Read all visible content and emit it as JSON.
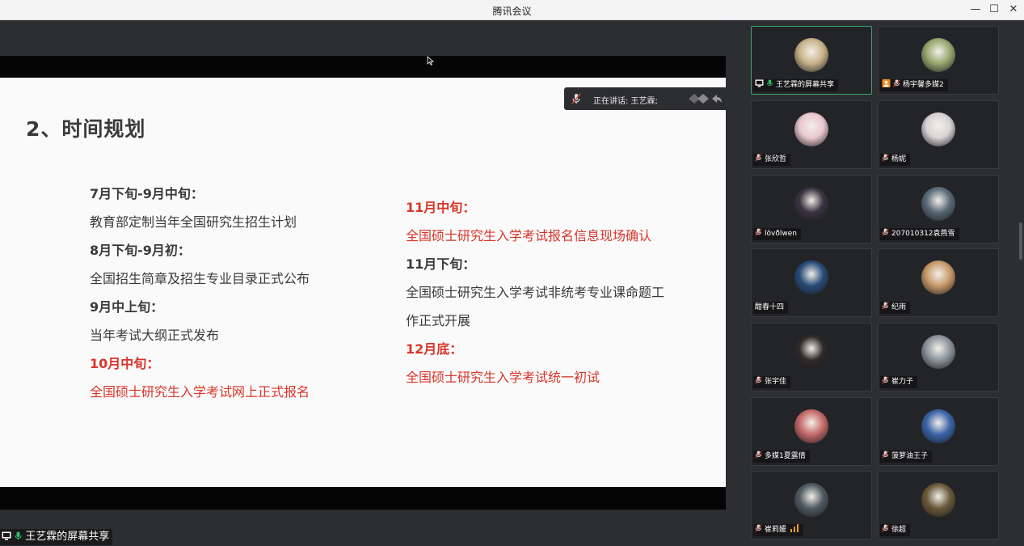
{
  "window": {
    "title": "腾讯会议",
    "minimize": "—",
    "maximize": "☐",
    "close": "✕"
  },
  "slide": {
    "title": "2、时间规划",
    "left_column": [
      {
        "text": "7月下旬-9月中旬：",
        "style": "h"
      },
      {
        "text": "教育部定制当年全国研究生招生计划",
        "style": "t"
      },
      {
        "text": "8月下旬-9月初：",
        "style": "h"
      },
      {
        "text": "全国招生简章及招生专业目录正式公布",
        "style": "t"
      },
      {
        "text": "9月中上旬：",
        "style": "h"
      },
      {
        "text": "当年考试大纲正式发布",
        "style": "t"
      },
      {
        "text": "10月中旬：",
        "style": "hr"
      },
      {
        "text": "全国硕士研究生入学考试网上正式报名",
        "style": "tr"
      }
    ],
    "right_column": [
      {
        "text": "11月中旬：",
        "style": "hr"
      },
      {
        "text": "全国硕士研究生入学考试报名信息现场确认",
        "style": "tr"
      },
      {
        "text": "11月下旬：",
        "style": "h"
      },
      {
        "text": "全国硕士研究生入学考试非统考专业课命题工",
        "style": "t"
      },
      {
        "text": "作正式开展",
        "style": "t"
      },
      {
        "text": "12月底：",
        "style": "hr"
      },
      {
        "text": "全国硕士研究生入学考试统一初试",
        "style": "tr"
      }
    ]
  },
  "speaking": {
    "label": "正在讲话: 王艺霖;"
  },
  "outline_icon": "list-icon",
  "share_label": "王艺霖的屏幕共享",
  "participants": [
    {
      "name": "王艺霖的屏幕共享",
      "badge": "screen-share",
      "active": true,
      "avatar": "#c9b48a"
    },
    {
      "name": "杨宇馨多媒2",
      "badge": "orange-user",
      "active": false,
      "avatar": "#9aa870"
    },
    {
      "name": "张欣哲",
      "badge": "mic-muted",
      "active": false,
      "avatar": "#e9c7cf"
    },
    {
      "name": "杨妮",
      "badge": "mic-muted",
      "active": false,
      "avatar": "#d8d4d6"
    },
    {
      "name": "lövðlwen",
      "badge": "mic-muted",
      "active": false,
      "avatar": "#3a3340"
    },
    {
      "name": "207010312袁燕雪",
      "badge": "mic-muted",
      "active": false,
      "avatar": "#5a6a78"
    },
    {
      "name": "酣春十四",
      "badge": "none",
      "active": false,
      "avatar": "#284c78"
    },
    {
      "name": "纪雨",
      "badge": "mic-muted",
      "active": false,
      "avatar": "#c79a6a"
    },
    {
      "name": "张宇佳",
      "badge": "mic-muted",
      "active": false,
      "avatar": "#2f2a2a"
    },
    {
      "name": "崔力子",
      "badge": "mic-muted",
      "active": false,
      "avatar": "#8c949c"
    },
    {
      "name": "多媒1夏露倩",
      "badge": "mic-muted",
      "active": false,
      "avatar": "#c56a6a"
    },
    {
      "name": "菠萝油王子",
      "badge": "mic-muted",
      "active": false,
      "avatar": "#3a64a8"
    },
    {
      "name": "崔莉媛",
      "badge": "mic-muted",
      "active": false,
      "avatar": "#505a62",
      "volume": true
    },
    {
      "name": "徐超",
      "badge": "mic-muted",
      "active": false,
      "avatar": "#6a5a3a"
    }
  ],
  "colors": {
    "accent_red": "#d8352a",
    "active_border": "#3aa66b",
    "orange": "#f08a24"
  }
}
